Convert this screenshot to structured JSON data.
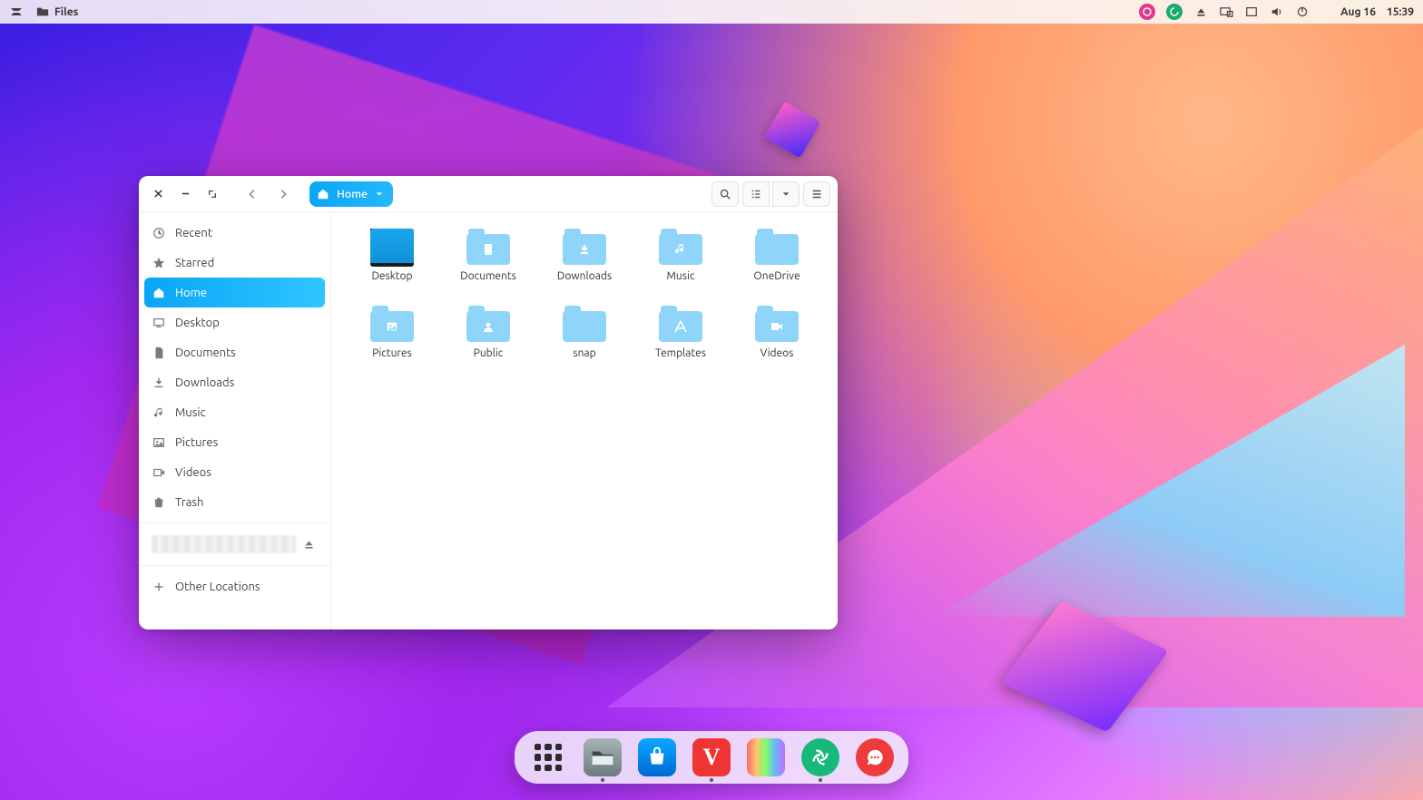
{
  "panel": {
    "app_label": "Files",
    "date": "Aug 16",
    "time": "15:39"
  },
  "window": {
    "path_label": "Home"
  },
  "sidebar": {
    "items": [
      {
        "label": "Recent",
        "icon": "clock"
      },
      {
        "label": "Starred",
        "icon": "star"
      },
      {
        "label": "Home",
        "icon": "home",
        "active": true
      },
      {
        "label": "Desktop",
        "icon": "desktop"
      },
      {
        "label": "Documents",
        "icon": "document"
      },
      {
        "label": "Downloads",
        "icon": "download"
      },
      {
        "label": "Music",
        "icon": "music"
      },
      {
        "label": "Pictures",
        "icon": "pictures"
      },
      {
        "label": "Videos",
        "icon": "videos"
      },
      {
        "label": "Trash",
        "icon": "trash"
      }
    ],
    "other_locations": "Other Locations"
  },
  "folders": [
    {
      "label": "Desktop",
      "emblem": "desktop"
    },
    {
      "label": "Documents",
      "emblem": "document"
    },
    {
      "label": "Downloads",
      "emblem": "download"
    },
    {
      "label": "Music",
      "emblem": "music"
    },
    {
      "label": "OneDrive",
      "emblem": ""
    },
    {
      "label": "Pictures",
      "emblem": "pictures"
    },
    {
      "label": "Public",
      "emblem": "public"
    },
    {
      "label": "snap",
      "emblem": ""
    },
    {
      "label": "Templates",
      "emblem": "templates"
    },
    {
      "label": "Videos",
      "emblem": "videos"
    }
  ],
  "dock": {
    "items": [
      "apps",
      "files",
      "store",
      "vivaldi",
      "colors",
      "element",
      "chat"
    ]
  }
}
